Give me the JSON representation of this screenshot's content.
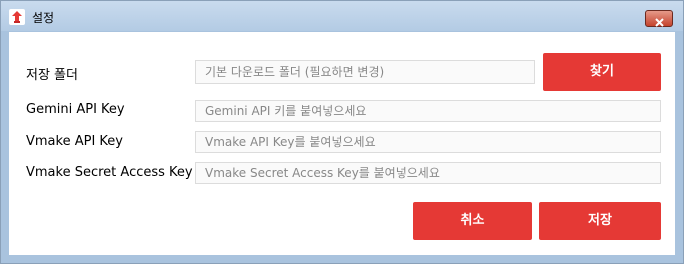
{
  "window": {
    "title": "설정",
    "icon": "app-logo-icon",
    "close_icon": "close-icon"
  },
  "form": {
    "fields": [
      {
        "label": "저장 폴더",
        "placeholder": "기본 다운로드 폴더 (필요하면 변경)"
      },
      {
        "label": "Gemini API Key",
        "placeholder": "Gemini API 키를 붙여넣으세요"
      },
      {
        "label": "Vmake API Key",
        "placeholder": "Vmake API Key를 붙여넣으세요"
      },
      {
        "label": "Vmake Secret Access Key",
        "placeholder": "Vmake Secret Access Key를 붙여넣으세요"
      }
    ]
  },
  "buttons": {
    "browse": "찾기",
    "cancel": "취소",
    "save": "저장"
  },
  "colors": {
    "accent": "#e53935",
    "titlebar": "#b9cee6"
  }
}
